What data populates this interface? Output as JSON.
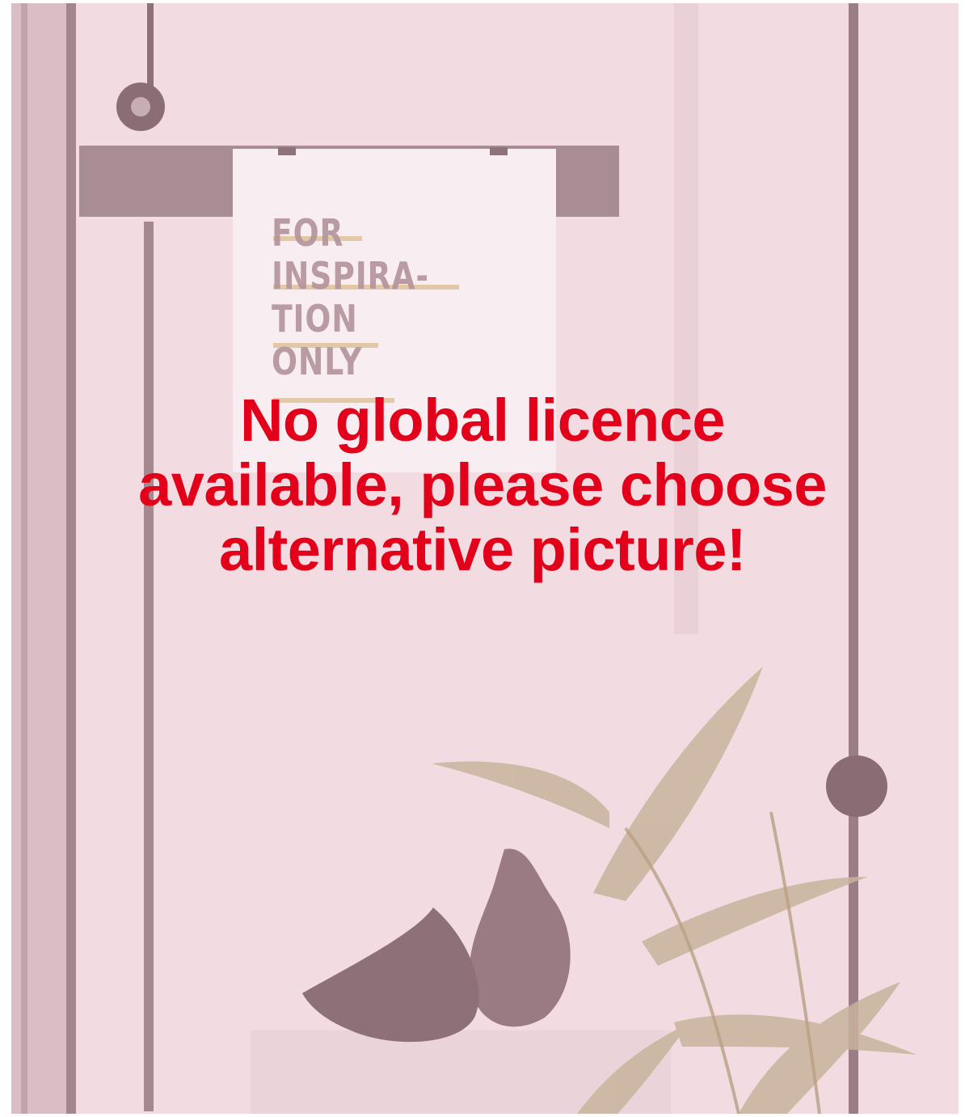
{
  "poster": {
    "lines": [
      "FOR",
      "INSPIRA-",
      "TION",
      "ONLY"
    ]
  },
  "notice": {
    "lines": [
      "No global licence",
      "available, please choose",
      "alternative picture!"
    ],
    "color": "#e2001a"
  },
  "colors": {
    "tint_background": "#f1d8df",
    "dark_tone": "#9c7f86"
  }
}
